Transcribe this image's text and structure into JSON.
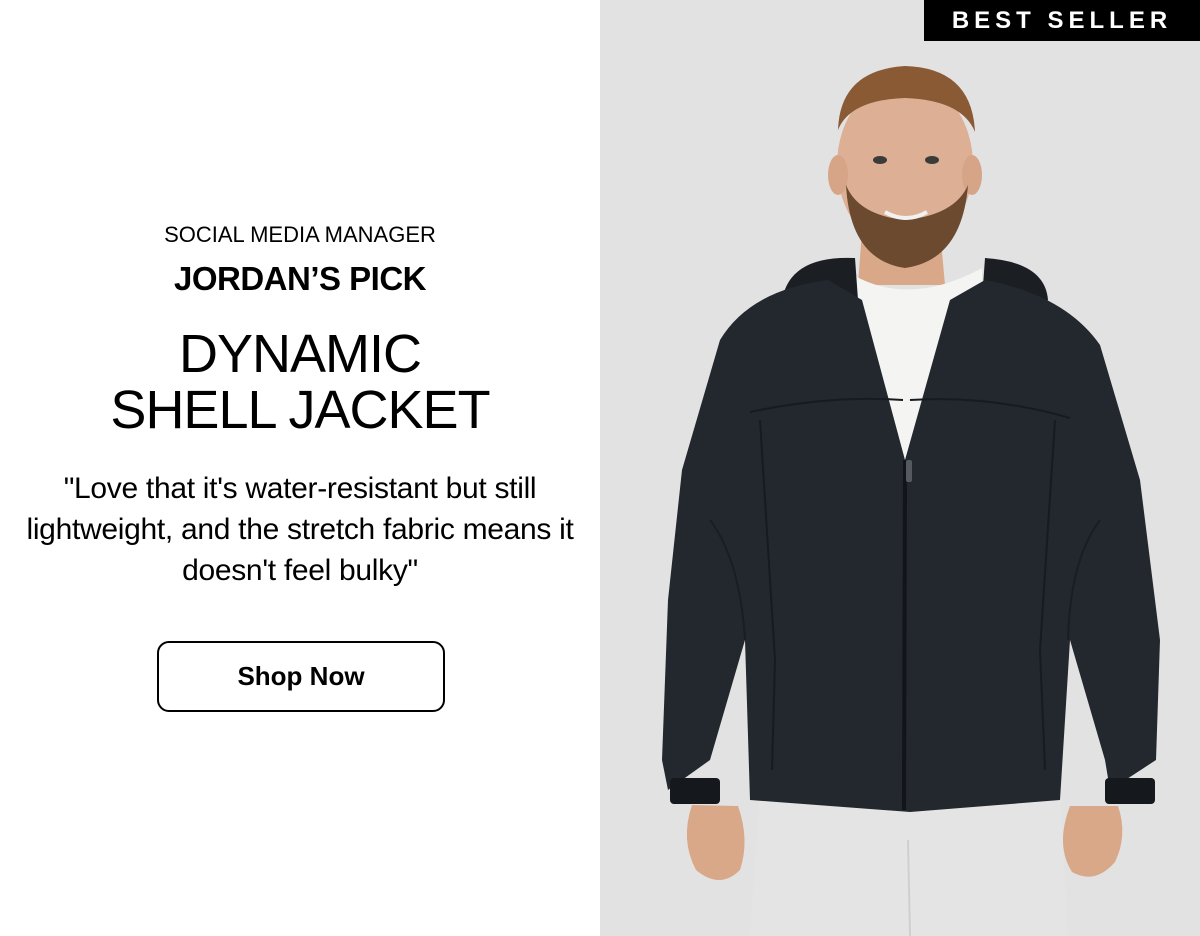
{
  "promo": {
    "eyebrow": "SOCIAL MEDIA MANAGER",
    "pick": "JORDAN’S PICK",
    "title_line1": "DYNAMIC",
    "title_line2": "SHELL JACKET",
    "quote": "\"Love that it's water-resistant but still lightweight, and the stretch fabric means it doesn't feel bulky\"",
    "cta_label": "Shop Now"
  },
  "image": {
    "badge": "BEST SELLER",
    "icon": "model-photo-jacket-icon"
  },
  "colors": {
    "background_left": "#ffffff",
    "background_right": "#e2e2e3",
    "jacket": "#23282e",
    "badge_bg": "#000000",
    "badge_text": "#ffffff"
  }
}
